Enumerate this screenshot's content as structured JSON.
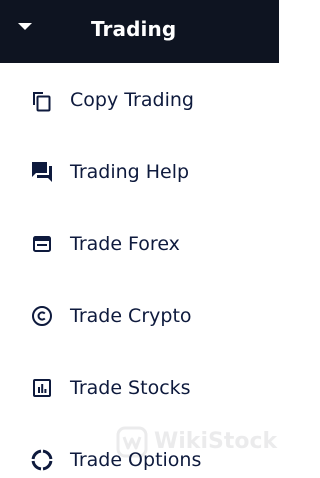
{
  "header": {
    "title": "Trading",
    "caret_icon": "caret-down-icon",
    "background": "#0e1421",
    "text_color": "#ffffff"
  },
  "menu": {
    "text_color": "#0e1a3d",
    "items": [
      {
        "label": "Copy Trading",
        "icon": "copy-icon"
      },
      {
        "label": "Trading Help",
        "icon": "chat-bubbles-icon"
      },
      {
        "label": "Trade Forex",
        "icon": "forex-card-icon"
      },
      {
        "label": "Trade Crypto",
        "icon": "copyright-circle-icon"
      },
      {
        "label": "Trade Stocks",
        "icon": "bar-chart-icon"
      },
      {
        "label": "Trade Options",
        "icon": "circle-segments-icon"
      }
    ]
  },
  "watermark": {
    "text": "WikiStock"
  }
}
